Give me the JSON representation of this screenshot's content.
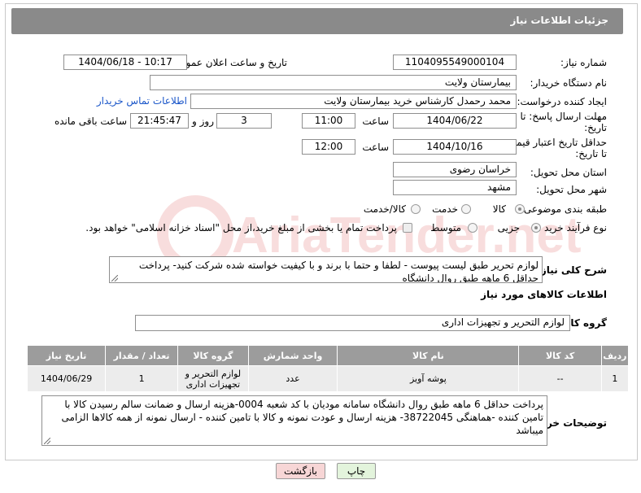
{
  "panel": {
    "title": "جزئیات اطلاعات نیاز"
  },
  "fields": {
    "need_number_label": "شماره نیاز:",
    "need_number": "1104095549000104",
    "announce_label": "تاریخ و ساعت اعلان عمومی:",
    "announce_value": "1404/06/18 - 10:17",
    "buyer_org_label": "نام دستگاه خریدار:",
    "buyer_org": "بیمارستان ولایت",
    "creator_label": "ایجاد کننده درخواست:",
    "creator": "محمد رحمدل کارشناس خرید بیمارستان ولایت",
    "contact_link": "اطلاعات تماس خریدار",
    "deadline_label_1": "مهلت ارسال پاسخ: تا",
    "deadline_label_2": "تاریخ:",
    "deadline_date": "1404/06/22",
    "time_label": "ساعت",
    "deadline_time": "11:00",
    "days_value": "3",
    "days_label": "روز و",
    "remaining_time": "21:45:47",
    "remaining_label": "ساعت باقی مانده",
    "validity_label_1": "حداقل تاریخ اعتبار قیمت:",
    "validity_label_2": "تا تاریخ:",
    "validity_date": "1404/10/16",
    "validity_time": "12:00",
    "province_label": "استان محل تحویل:",
    "province": "خراسان رضوی",
    "city_label": "شهر محل تحویل:",
    "city": "مشهد",
    "category_label": "طبقه بندی موضوعی:",
    "category_options": [
      "کالا",
      "خدمت",
      "کالا/خدمت"
    ],
    "category_selected": "کالا",
    "process_label": "نوع فرآیند خرید :",
    "process_options": [
      "جزیی",
      "متوسط"
    ],
    "process_selected": "جزیی",
    "payment_note": "پرداخت تمام یا بخشی از مبلغ خرید،از محل \"اسناد خزانه اسلامی\" خواهد بود.",
    "summary_label": "شرح کلی نیاز:",
    "summary": "لوازم تحریر طبق لیست پیوست - لطفا و حتما با برند و با کیفیت خواسته شده شرکت کنید- پرداخت حداقل 6 ماهه طبق روال دانشگاه"
  },
  "goods": {
    "section_title": "اطلاعات کالاهای مورد نیاز",
    "group_label": "گروه کالا:",
    "group_value": "لوازم التحریر و تجهیزات اداری",
    "columns": [
      "ردیف",
      "کد کالا",
      "نام کالا",
      "واحد شمارش",
      "گروه کالا",
      "تعداد / مقدار",
      "تاریخ نیاز"
    ],
    "rows": [
      [
        "1",
        "--",
        "پوشه آویز",
        "عدد",
        "لوازم التحریر و تجهیزات اداری",
        "1",
        "1404/06/29"
      ]
    ]
  },
  "buyer_notes": {
    "label": "توضیحات خریدار:",
    "text": "پرداخت حداقل 6 ماهه طبق روال دانشگاه سامانه مودیان با کد شعبه 0004-هزینه ارسال و ضمانت سالم رسیدن کالا با تامین کننده -هماهنگی 38722045-  هزینه ارسال و عودت نمونه و کالا با تامین کننده - ارسال نمونه از همه کالاها الزامی میباشد"
  },
  "buttons": {
    "print": "چاپ",
    "back": "بازگشت"
  },
  "watermark": {
    "text": "AriaTender.net"
  },
  "colors": {
    "header_bg": "#8a8a8a",
    "link": "#1a56c9",
    "back_bg": "#f7d6d6",
    "print_bg": "#e3f4dc"
  }
}
